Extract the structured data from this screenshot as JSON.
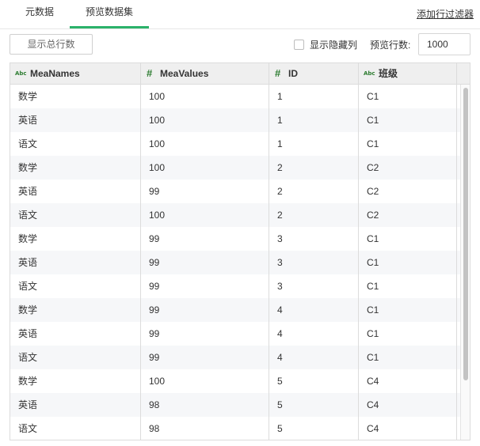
{
  "tabs": [
    {
      "label": "元数据",
      "active": false
    },
    {
      "label": "预览数据集",
      "active": true
    }
  ],
  "accent_color": "#2bb26a",
  "add_filter_label": "添加行过滤器",
  "toolbar": {
    "show_total_label": "显示总行数",
    "show_hidden_label": "显示隐藏列",
    "show_hidden_checked": false,
    "preview_rows_label": "预览行数:",
    "preview_rows_value": "1000"
  },
  "columns": [
    {
      "label": "MeaNames",
      "type_icon": "abc-icon"
    },
    {
      "label": "MeaValues",
      "type_icon": "hash-icon"
    },
    {
      "label": "ID",
      "type_icon": "hash-icon"
    },
    {
      "label": "班级",
      "type_icon": "abc-icon"
    }
  ],
  "rows": [
    [
      "数学",
      "100",
      "1",
      "C1"
    ],
    [
      "英语",
      "100",
      "1",
      "C1"
    ],
    [
      "语文",
      "100",
      "1",
      "C1"
    ],
    [
      "数学",
      "100",
      "2",
      "C2"
    ],
    [
      "英语",
      "99",
      "2",
      "C2"
    ],
    [
      "语文",
      "100",
      "2",
      "C2"
    ],
    [
      "数学",
      "99",
      "3",
      "C1"
    ],
    [
      "英语",
      "99",
      "3",
      "C1"
    ],
    [
      "语文",
      "99",
      "3",
      "C1"
    ],
    [
      "数学",
      "99",
      "4",
      "C1"
    ],
    [
      "英语",
      "99",
      "4",
      "C1"
    ],
    [
      "语文",
      "99",
      "4",
      "C1"
    ],
    [
      "数学",
      "100",
      "5",
      "C4"
    ],
    [
      "英语",
      "98",
      "5",
      "C4"
    ],
    [
      "语文",
      "98",
      "5",
      "C4"
    ]
  ]
}
